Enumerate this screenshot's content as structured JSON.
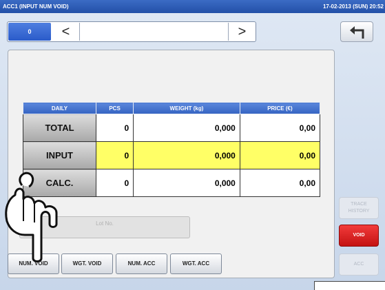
{
  "titlebar": {
    "title": "ACC1 (INPUT NUM VOID)",
    "datetime": "17-02-2013 (SUN)  20:52"
  },
  "nav": {
    "value": "0",
    "prev_glyph": "<",
    "next_glyph": ">"
  },
  "back_icon": "return-arrow-icon",
  "table": {
    "headers": [
      "DAILY",
      "PCS",
      "WEIGHT (kg)",
      "PRICE (€)"
    ],
    "rows": [
      {
        "label": "TOTAL",
        "pcs": "0",
        "weight": "0,000",
        "price": "0,00"
      },
      {
        "label": "INPUT",
        "pcs": "0",
        "weight": "0,000",
        "price": "0,00"
      },
      {
        "label": "CALC.",
        "pcs": "0",
        "weight": "0,000",
        "price": "0,00"
      }
    ]
  },
  "lot_button": "Lot No.",
  "tabs": [
    "NUM. VOID",
    "WGT. VOID",
    "NUM. ACC",
    "WGT. ACC"
  ],
  "side": {
    "trace": "TRACE HISTORY",
    "void": "VOID",
    "acc": "ACC"
  },
  "colors": {
    "title_blue": "#2350a8",
    "input_highlight": "#ffff66",
    "void_red": "#e02020"
  }
}
